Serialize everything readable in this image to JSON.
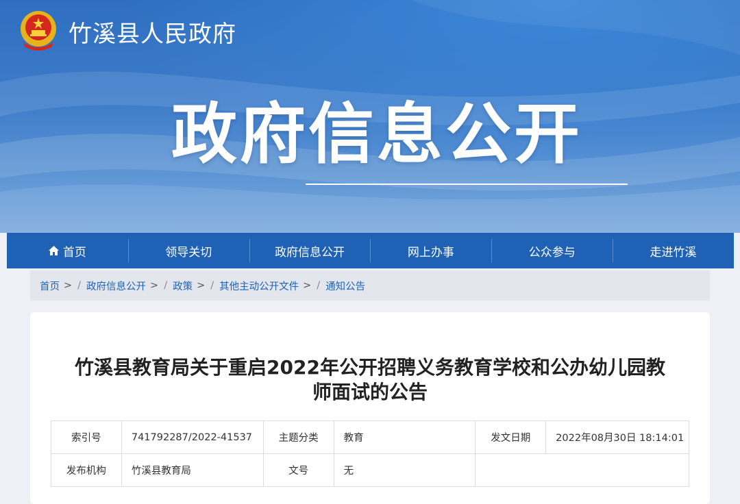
{
  "header": {
    "site_name": "竹溪县人民政府",
    "banner_title": "政府信息公开",
    "emblem_icon": "national-emblem-icon"
  },
  "nav": {
    "items": [
      {
        "label": "首页",
        "icon": "home-icon"
      },
      {
        "label": "领导关切"
      },
      {
        "label": "政府信息公开"
      },
      {
        "label": "网上办事"
      },
      {
        "label": "公众参与"
      },
      {
        "label": "走进竹溪"
      }
    ]
  },
  "breadcrumb": {
    "items": [
      "首页",
      "政府信息公开",
      "政策",
      "其他主动公开文件",
      "通知公告"
    ],
    "separator": ">"
  },
  "document": {
    "title_line1": "竹溪县教育局关于重启2022年公开招聘义务教育学校和公办幼儿园教",
    "title_line2": "师面试的公告",
    "meta": {
      "index_label": "索引号",
      "index_value": "741792287/2022-41537",
      "topic_label": "主题分类",
      "topic_value": "教育",
      "date_label": "发文日期",
      "date_value": "2022年08月30日 18:14:01",
      "issuer_label": "发布机构",
      "issuer_value": "竹溪县教育局",
      "docno_label": "文号",
      "docno_value": "无"
    }
  },
  "colors": {
    "nav_bg": "#1f62b5",
    "link": "#1f62b5",
    "banner": "#3f7dca"
  }
}
